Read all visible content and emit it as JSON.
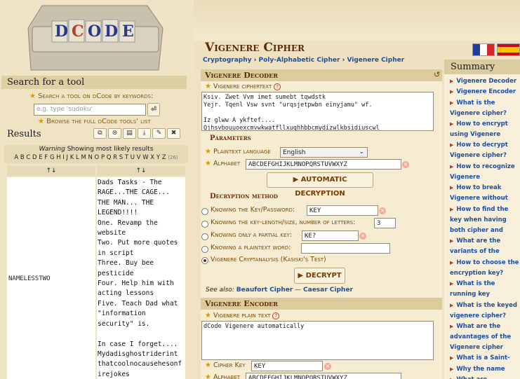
{
  "logo": {
    "letters": "DCODE"
  },
  "search": {
    "title": "Search for a tool",
    "keyword_link": "Search a tool on dCode by keywords:",
    "placeholder": "e.g. type 'sudoku'",
    "go": "⏎",
    "browse_link": "Browse the full dCode tools' list"
  },
  "results": {
    "title": "Results",
    "toolbar": [
      "⧉",
      "⊜",
      "▤",
      "⤓",
      "✎",
      "✖"
    ],
    "warning_label": "Warning",
    "warning_text": "Showing most likely results",
    "alphabet": "A B C D E F G H I J K L M N O P Q R S T U V W X Y Z",
    "count": "(26)",
    "col1_sort": "↑↓",
    "col2_sort": "↑↓",
    "key": "NAMELESSTWO",
    "text": "Dads Tasks - The\nRAGE...THE CAGE...\nTHE MAN... THE\nLEGEND!!!!\nOne. Revamp the\nwebsite\nTwo. Put more quotes\nin script\nThree. Buy bee\npesticide\nFour. Help him with\nacting lessons\nFive. Teach Dad what\n\"information\nsecurity\" is.\n\nIn case I forget....\nMydadisghostriderint\nthatcoolnocausehesonf\nirejokes"
  },
  "header": {
    "title": "Vigenere Cipher",
    "flags": [
      "fr-flag",
      "es-flag"
    ]
  },
  "breadcrumb": {
    "a": "Cryptography",
    "b": "Poly-Alphabetic Cipher",
    "c": "Vigenere Cipher",
    "sep": "›"
  },
  "decoder": {
    "title": "Vigenere Decoder",
    "reset": "↺",
    "ciphertext_label": "Vigenere ciphertext",
    "ciphertext": "Ksiv. Zwet Vvm imet sumebt tqwdstk\nYejr. Tqenl Vsw svnt \"urqsjetpwbn einyjamu\" wf.\n\nIz glww A ykftef....\nQjhsvbouuoexcmvwkwatfllxughhbbcmydizwlkbsidiuscwl",
    "params_title": "Parameters",
    "plaintext_lang_label": "Plaintext language",
    "plaintext_lang": "English",
    "alphabet_label": "Alphabet",
    "alphabet": "ABCDEFGHIJKLMNOPQRSTUVWXYZ",
    "auto_button": "▶ AUTOMATIC DECRYPTION",
    "method_title": "Decryption method",
    "opt_key": "Knowing the Key/Password:",
    "opt_key_value": "KEY",
    "opt_len": "Knowing the key-length/size, number of letters:",
    "opt_len_value": "3",
    "opt_partial": "Knowing only a partial key:",
    "opt_partial_value": "KE?",
    "opt_word": "Knowing a plaintext word:",
    "opt_word_value": "",
    "opt_kasiski": "Vigenere Cryptanalysis (Kasiski's Test)",
    "decrypt_button": "▶ DECRYPT",
    "see_also": "See also:",
    "see1": "Beaufort Cipher",
    "see_sep": " — ",
    "see2": "Caesar Cipher"
  },
  "encoder": {
    "title": "Vigenere Encoder",
    "plain_label": "Vigenere plain text",
    "plain": "dCode Vigenere automatically",
    "key_label": "Cipher Key",
    "key": "KEY",
    "alphabet_label": "Alphabet",
    "alphabet": "ABCDEFGHIJKLMNOPQRSTUVWXYZ"
  },
  "summary": {
    "title": "Summary",
    "items": [
      "Vigenere Decoder",
      "Vigenere Encoder",
      "What is the Vigenere cipher? (Definition)",
      "How to encrypt using Vigenere cipher?",
      "How to decrypt Vigenere cipher?",
      "How to recognize Vigenere ciphertext?",
      "How to break Vigenere without knowing the key?",
      "How to find the key when having both cipher and plaintext?",
      "What are the variants of the Vigenere cipher?",
      "How to choose the encryption key?",
      "What is the running key vigenere cipher?",
      "What is the keyed vigenere cipher?",
      "What are the advantages of the Vigenere cipher versus Caesar Cipher?",
      "What is a Saint-Cyr slide?",
      "Why the name Vigenere?",
      "What are..."
    ]
  }
}
